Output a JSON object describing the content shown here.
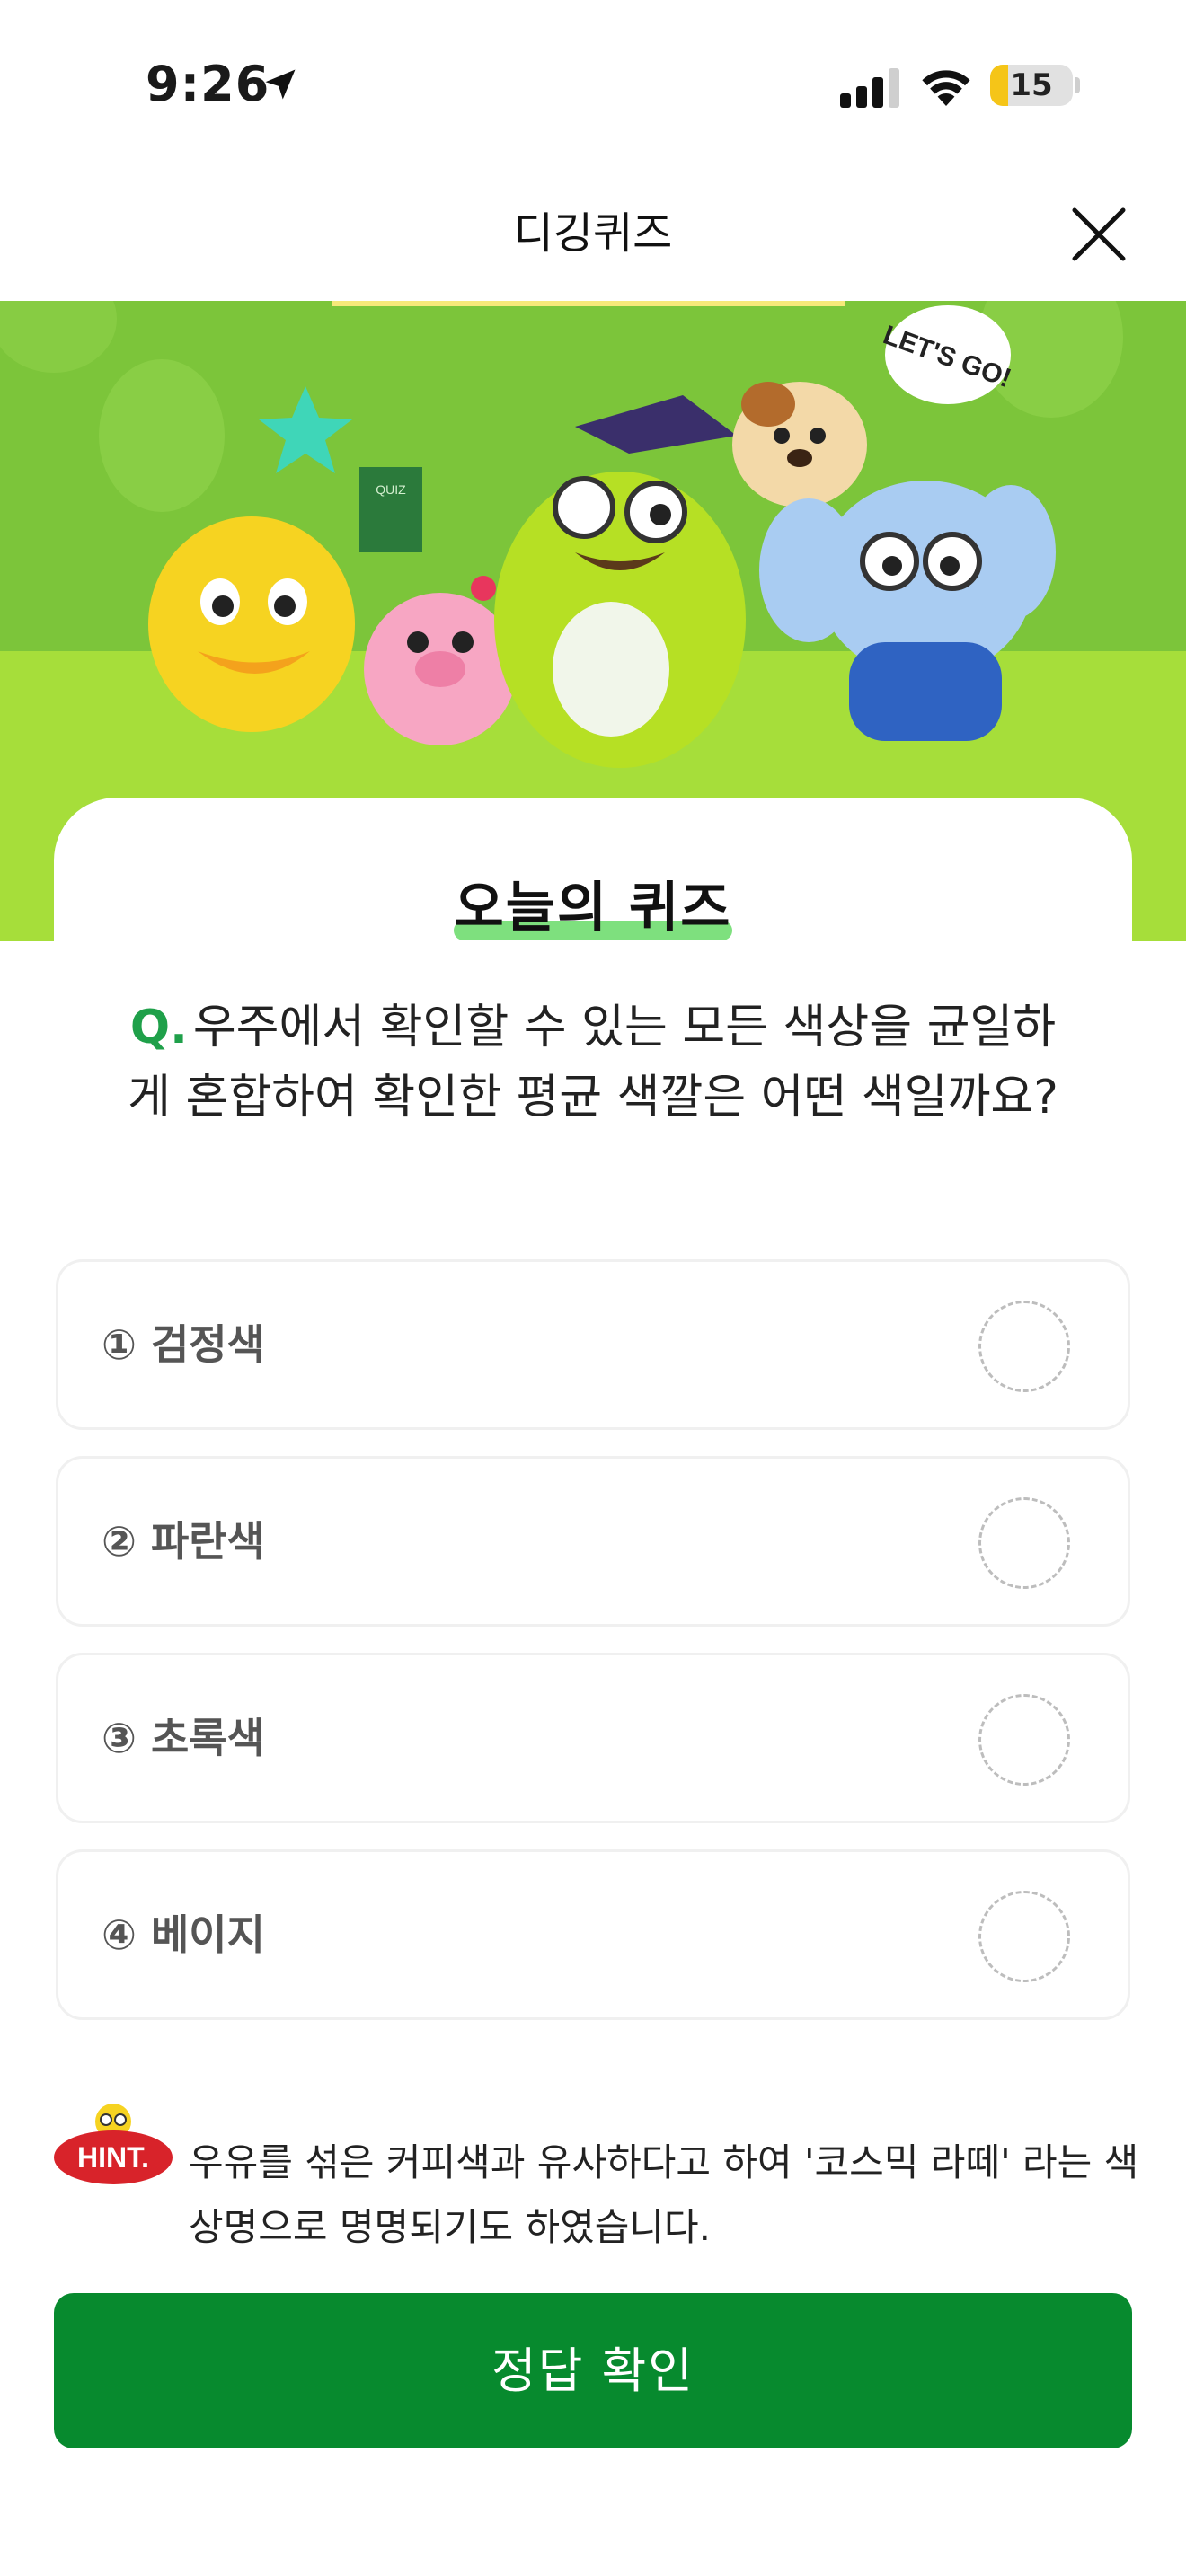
{
  "status_bar": {
    "time": "9:26",
    "battery_level": "15"
  },
  "header": {
    "title": "디깅퀴즈"
  },
  "banner": {
    "bubble_text": "LET'S GO!",
    "book_label": "QUIZ"
  },
  "quiz": {
    "heading": "오늘의 퀴즈",
    "q_prefix": "Q.",
    "question": "우주에서 확인할 수 있는 모든 색상을 균일하게 혼합하여 확인한 평균 색깔은 어떤 색일까요?",
    "options": [
      {
        "label": "① 검정색"
      },
      {
        "label": "② 파란색"
      },
      {
        "label": "③ 초록색"
      },
      {
        "label": "④ 베이지"
      }
    ]
  },
  "hint": {
    "badge": "HINT.",
    "text": "우유를 섞은 커피색과 유사하다고 하여 '코스믹 라떼' 라는 색상명으로 명명되기도 하였습니다."
  },
  "submit": {
    "label": "정답 확인"
  },
  "colors": {
    "accent_green": "#078a2e",
    "banner_green": "#a6de3a",
    "hint_red": "#d8232a",
    "battery_yellow": "#f5c518"
  }
}
